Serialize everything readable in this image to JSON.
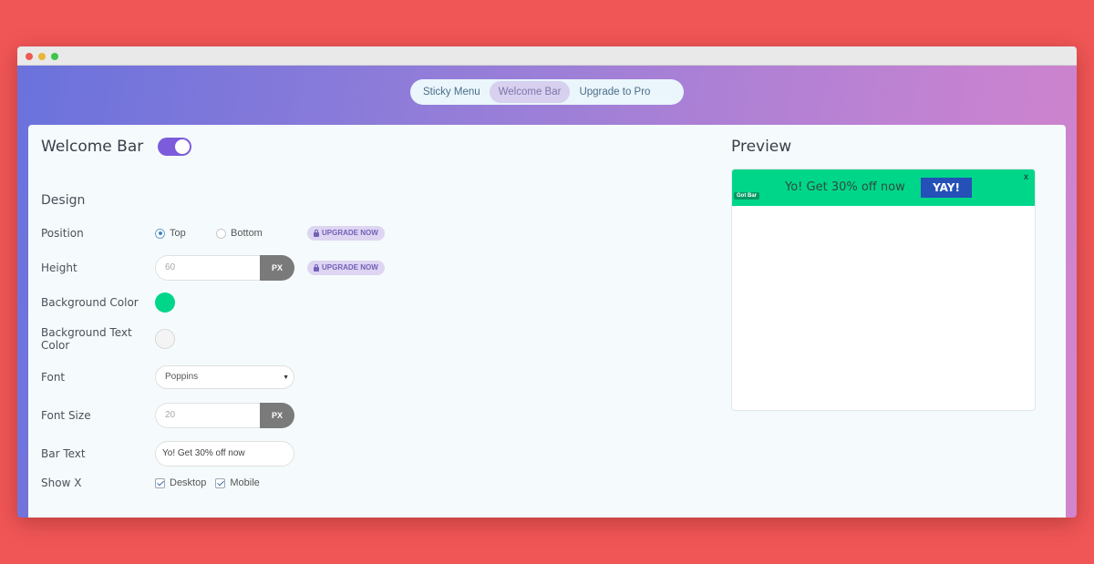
{
  "tabs": [
    {
      "label": "Sticky Menu",
      "active": false
    },
    {
      "label": "Welcome Bar",
      "active": true
    },
    {
      "label": "Upgrade to Pro",
      "active": false
    }
  ],
  "header": {
    "title": "Welcome Bar",
    "enabled": true
  },
  "design": {
    "section_title": "Design",
    "position": {
      "label": "Position",
      "options": [
        "Top",
        "Bottom"
      ],
      "selected": "Top"
    },
    "upgrade_label": "UPGRADE NOW",
    "height": {
      "label": "Height",
      "value": "60",
      "unit": "PX"
    },
    "background_color": {
      "label": "Background Color",
      "value": "#00d68a"
    },
    "background_text_color": {
      "label": "Background Text Color",
      "value": "#f4f4f4"
    },
    "font": {
      "label": "Font",
      "value": "Poppins"
    },
    "font_size": {
      "label": "Font Size",
      "value": "20",
      "unit": "PX"
    },
    "bar_text": {
      "label": "Bar Text",
      "value": "Yo! Get 30% off now"
    },
    "show_x": {
      "label": "Show X",
      "options": [
        {
          "label": "Desktop",
          "checked": true
        },
        {
          "label": "Mobile",
          "checked": true
        }
      ]
    }
  },
  "preview": {
    "title": "Preview",
    "bar_text": "Yo! Get 30% off now",
    "button_label": "YAY!",
    "close_label": "x",
    "brand_badge": "Got Bar",
    "bar_color": "#00d68a",
    "button_color": "#2450b8"
  }
}
